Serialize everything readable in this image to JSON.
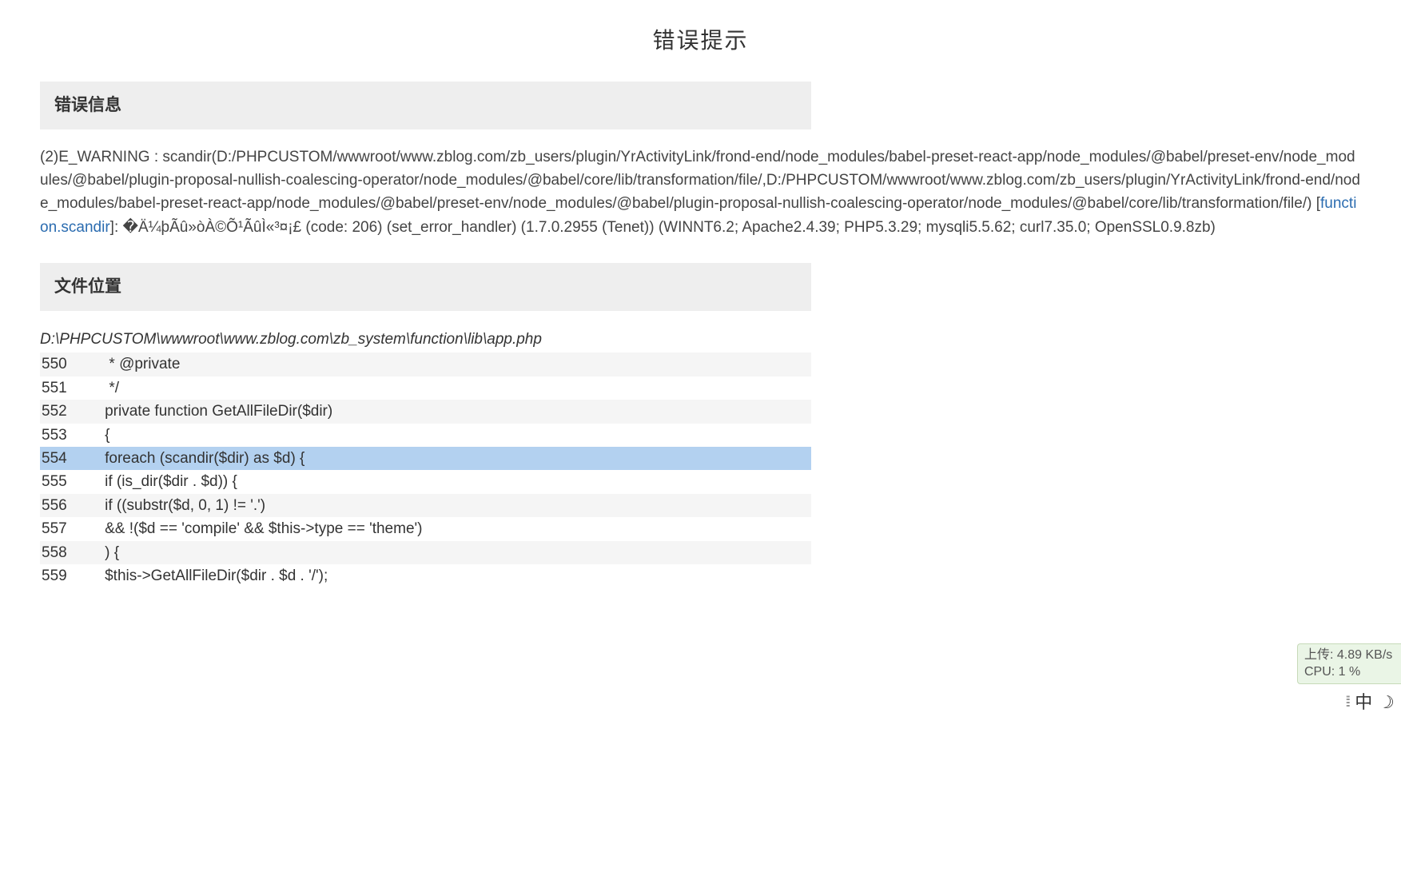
{
  "page": {
    "title": "错误提示"
  },
  "error": {
    "header": "错误信息",
    "message_pre": "(2)E_WARNING : scandir(D:/PHPCUSTOM/wwwroot/www.zblog.com/zb_users/plugin/YrActivityLink/frond-end/node_modules/babel-preset-react-app/node_modules/@babel/preset-env/node_modules/@babel/plugin-proposal-nullish-coalescing-operator/node_modules/@babel/core/lib/transformation/file/,D:/PHPCUSTOM/wwwroot/www.zblog.com/zb_users/plugin/YrActivityLink/frond-end/node_modules/babel-preset-react-app/node_modules/@babel/preset-env/node_modules/@babel/plugin-proposal-nullish-coalescing-operator/node_modules/@babel/core/lib/transformation/file/) [",
    "link_text": "function.scandir",
    "message_post": "]: �Ä¼þÃû»òÀ©Õ¹ÃûÌ«³¤¡£ (code: 206) (set_error_handler) (1.7.0.2955 (Tenet)) (WINNT6.2; Apache2.4.39; PHP5.3.29; mysqli5.5.62; curl7.35.0; OpenSSL0.9.8zb)"
  },
  "file": {
    "header": "文件位置",
    "path": "D:\\PHPCUSTOM\\wwwroot\\www.zblog.com\\zb_system\\function\\lib\\app.php",
    "highlighted_line": 554,
    "lines": [
      {
        "n": "550",
        "code": "     * @private"
      },
      {
        "n": "551",
        "code": "     */"
      },
      {
        "n": "552",
        "code": "    private function GetAllFileDir($dir)"
      },
      {
        "n": "553",
        "code": "    {"
      },
      {
        "n": "554",
        "code": "    foreach (scandir($dir) as $d) {"
      },
      {
        "n": "555",
        "code": "    if (is_dir($dir . $d)) {"
      },
      {
        "n": "556",
        "code": "    if ((substr($d, 0, 1) != '.')"
      },
      {
        "n": "557",
        "code": "    && !($d == 'compile' && $this->type == 'theme')"
      },
      {
        "n": "558",
        "code": "    ) {"
      },
      {
        "n": "559",
        "code": "    $this->GetAllFileDir($dir . $d . '/');"
      }
    ]
  },
  "status": {
    "upload_label": "上传: ",
    "upload_value": "4.89 KB/s",
    "cpu_label": "CPU: ",
    "cpu_value": "1 %"
  },
  "ime": {
    "grip": "⁞⁞",
    "lang": "中",
    "moon": "☽"
  }
}
